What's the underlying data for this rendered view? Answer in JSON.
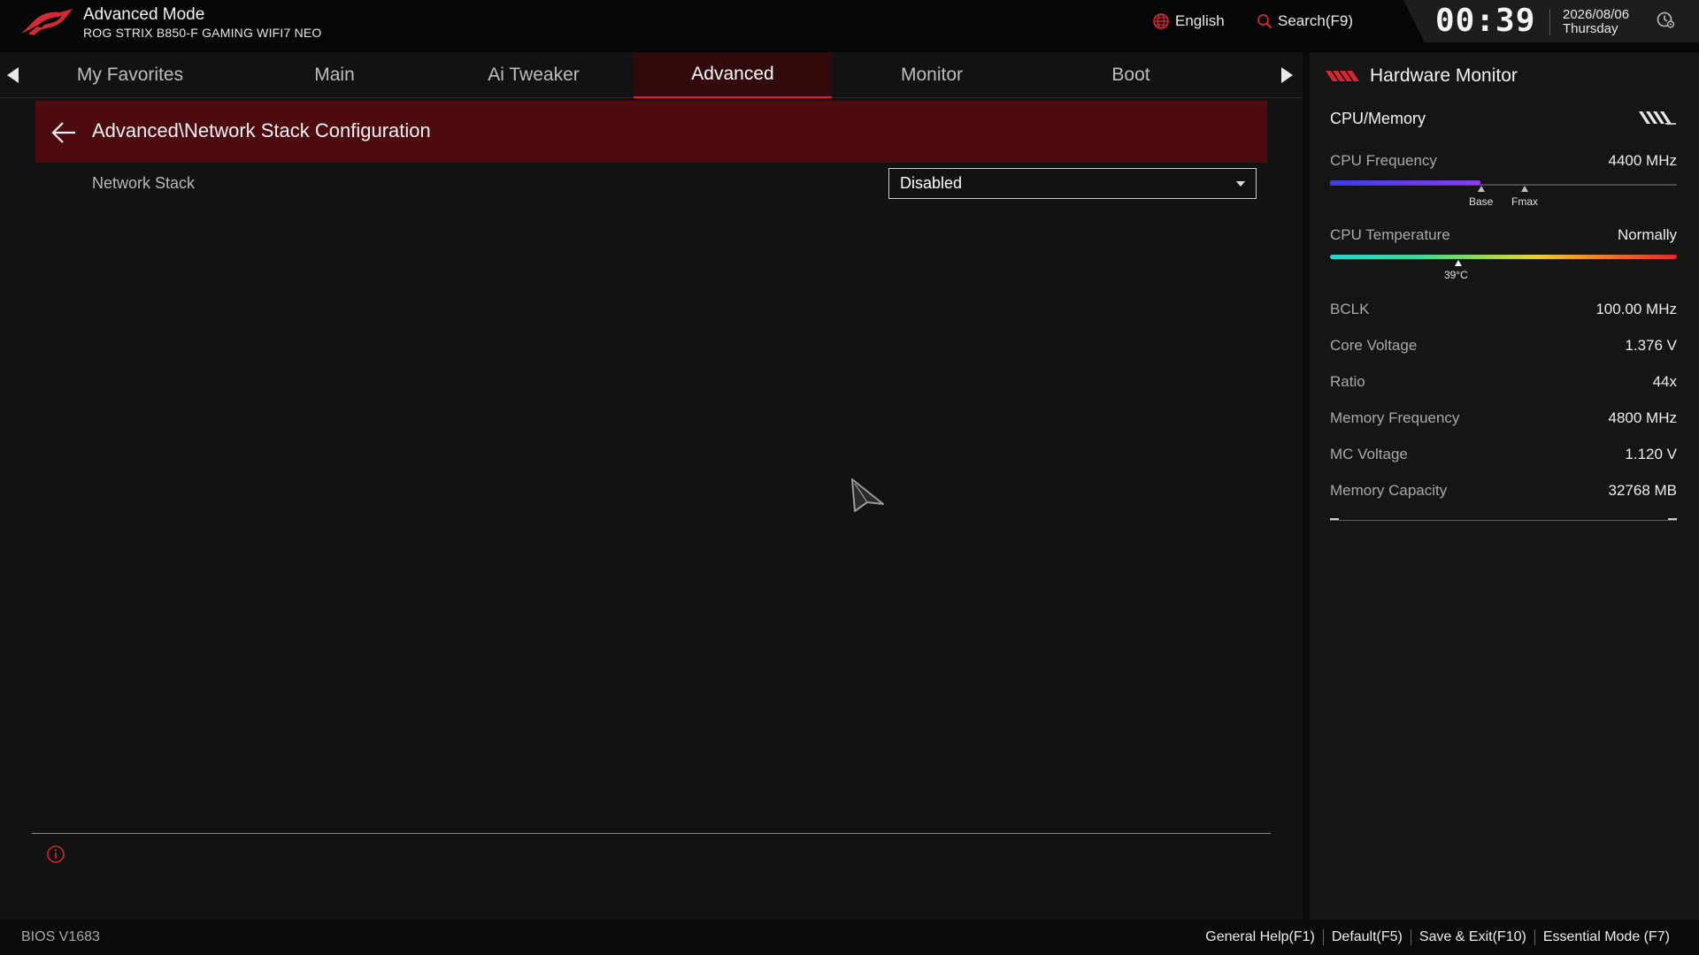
{
  "header": {
    "mode_title": "Advanced Mode",
    "board_name": "ROG STRIX B850-F GAMING WIFI7 NEO",
    "language": "English",
    "search_label": "Search(F9)",
    "clock": "00:39",
    "date": "2026/08/06",
    "weekday": "Thursday"
  },
  "tabs": [
    {
      "label": "My Favorites",
      "active": false
    },
    {
      "label": "Main",
      "active": false
    },
    {
      "label": "Ai Tweaker",
      "active": false
    },
    {
      "label": "Advanced",
      "active": true
    },
    {
      "label": "Monitor",
      "active": false
    },
    {
      "label": "Boot",
      "active": false
    }
  ],
  "content": {
    "breadcrumb": "Advanced\\Network Stack Configuration",
    "settings": [
      {
        "label": "Network Stack",
        "value": "Disabled"
      }
    ]
  },
  "hardware_monitor": {
    "title": "Hardware Monitor",
    "section": "CPU/Memory",
    "cpu_frequency": {
      "label": "CPU Frequency",
      "value": "4400 MHz",
      "base_label": "Base",
      "fmax_label": "Fmax"
    },
    "cpu_temperature": {
      "label": "CPU Temperature",
      "value": "Normally",
      "reading": "39°C"
    },
    "rows": [
      {
        "label": "BCLK",
        "value": "100.00 MHz"
      },
      {
        "label": "Core Voltage",
        "value": "1.376 V"
      },
      {
        "label": "Ratio",
        "value": "44x"
      },
      {
        "label": "Memory Frequency",
        "value": "4800 MHz"
      },
      {
        "label": "MC Voltage",
        "value": "1.120 V"
      },
      {
        "label": "Memory Capacity",
        "value": "32768 MB"
      }
    ]
  },
  "footer": {
    "bios_version": "BIOS V1683",
    "items": [
      "General Help(F1)",
      "Default(F5)",
      "Save & Exit(F10)",
      "Essential Mode (F7)"
    ]
  },
  "colors": {
    "accent_red": "#d6262f",
    "breadcrumb_bg": "#4d0b10",
    "background": "#121212"
  },
  "icons": [
    "rog-logo-icon",
    "globe-icon",
    "search-icon",
    "clock-settings-icon",
    "back-arrow-icon",
    "info-icon",
    "hardware-monitor-logo-icon",
    "cpu-memory-toggle-icon",
    "mouse-cursor-icon"
  ]
}
